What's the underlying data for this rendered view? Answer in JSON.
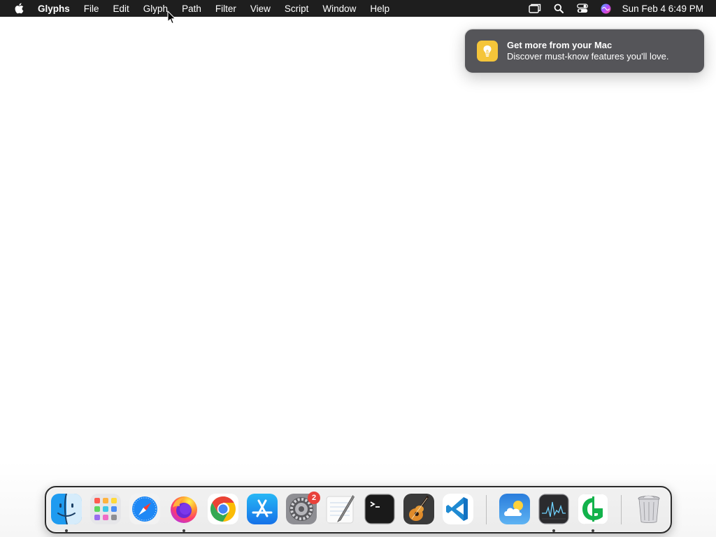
{
  "menubar": {
    "app_name": "Glyphs",
    "menus": [
      "File",
      "Edit",
      "Glyph",
      "Path",
      "Filter",
      "View",
      "Script",
      "Window",
      "Help"
    ],
    "status_icons": [
      "display-icon",
      "search-icon",
      "control-center-icon",
      "siri-icon"
    ],
    "clock": "Sun Feb 4  6:49 PM"
  },
  "notification": {
    "title": "Get more from your Mac",
    "body": "Discover must-know features you'll love.",
    "icon": "lightbulb-icon",
    "icon_color": "#f5c53a"
  },
  "dock": {
    "apps": [
      {
        "name": "Finder",
        "icon": "finder-icon",
        "running": true
      },
      {
        "name": "Launchpad",
        "icon": "launchpad-icon",
        "running": false
      },
      {
        "name": "Safari",
        "icon": "safari-icon",
        "running": false
      },
      {
        "name": "Firefox",
        "icon": "firefox-icon",
        "running": true
      },
      {
        "name": "Google Chrome",
        "icon": "chrome-icon",
        "running": false
      },
      {
        "name": "App Store",
        "icon": "app-store-icon",
        "running": false
      },
      {
        "name": "System Settings",
        "icon": "system-settings-icon",
        "running": false,
        "badge": "2"
      },
      {
        "name": "TextEdit",
        "icon": "textedit-icon",
        "running": false
      },
      {
        "name": "Terminal",
        "icon": "terminal-icon",
        "running": false
      },
      {
        "name": "GarageBand",
        "icon": "garageband-icon",
        "running": false
      },
      {
        "name": "Visual Studio Code",
        "icon": "vscode-icon",
        "running": false
      },
      {
        "name": "Weather",
        "icon": "weather-icon",
        "running": false
      },
      {
        "name": "Activity Monitor",
        "icon": "activity-monitor-icon",
        "running": true
      },
      {
        "name": "Glyphs",
        "icon": "glyphs-icon",
        "running": true
      },
      {
        "name": "Trash",
        "icon": "trash-icon",
        "running": false
      }
    ]
  }
}
